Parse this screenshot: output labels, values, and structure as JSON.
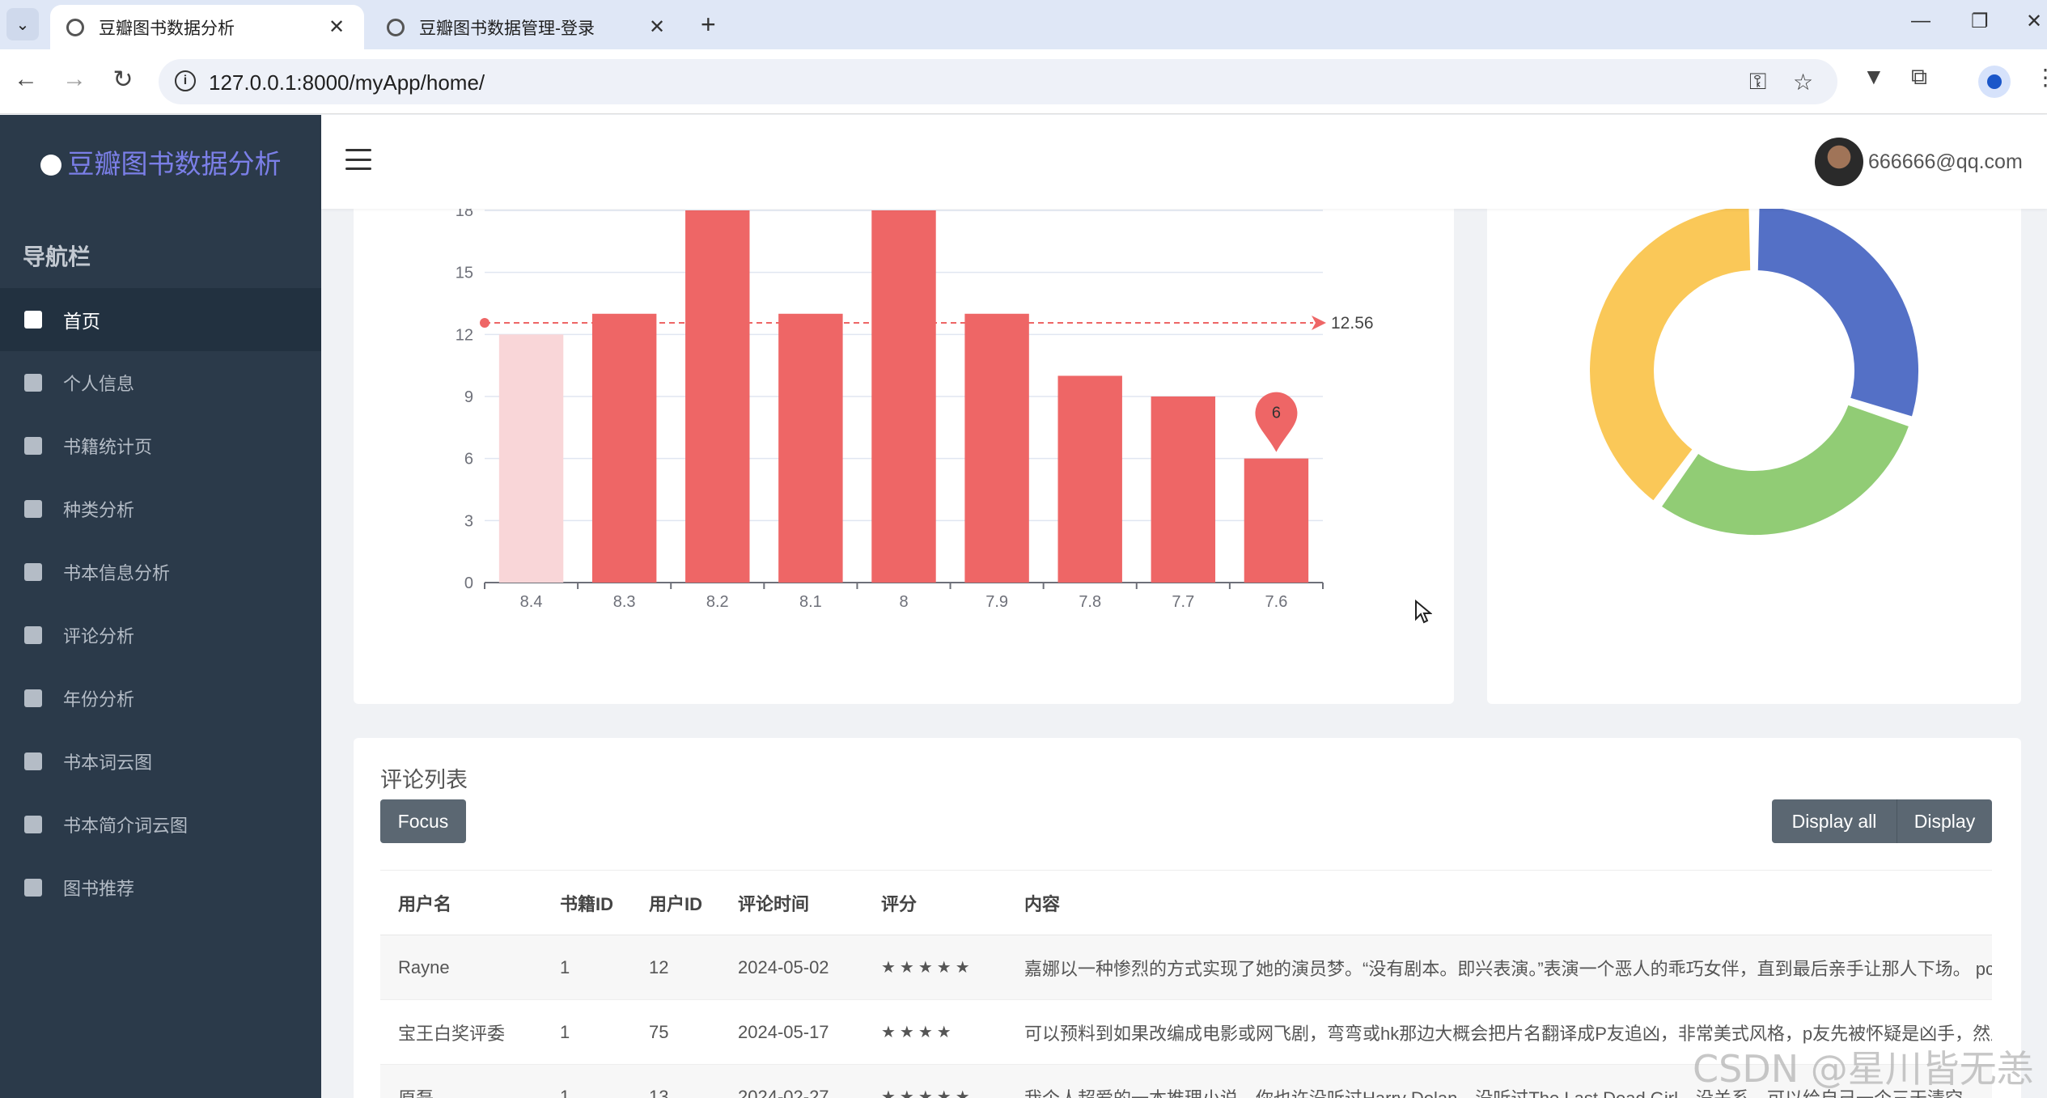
{
  "browser": {
    "tabs": [
      {
        "title": "豆瓣图书数据分析",
        "active": true
      },
      {
        "title": "豆瓣图书数据管理-登录",
        "active": false
      }
    ],
    "url": "127.0.0.1:8000/myApp/home/"
  },
  "app": {
    "brand": "豆瓣图书数据分析",
    "nav_heading": "导航栏",
    "nav_items": [
      {
        "label": "首页",
        "icon": "dashboard-icon",
        "active": true
      },
      {
        "label": "个人信息",
        "icon": "user-info-icon"
      },
      {
        "label": "书籍统计页",
        "icon": "calendar-check-icon"
      },
      {
        "label": "种类分析",
        "icon": "print-icon"
      },
      {
        "label": "书本信息分析",
        "icon": "book-icon"
      },
      {
        "label": "评论分析",
        "icon": "comment-icon"
      },
      {
        "label": "年份分析",
        "icon": "history-icon"
      },
      {
        "label": "书本词云图",
        "icon": "cloud-icon"
      },
      {
        "label": "书本简介词云图",
        "icon": "cloud-upload-icon"
      },
      {
        "label": "图书推荐",
        "icon": "plus-square-icon"
      }
    ],
    "user_email": "666666@qq.com"
  },
  "chart_data": [
    {
      "type": "bar",
      "categories": [
        "8.4",
        "8.3",
        "8.2",
        "8.1",
        "8",
        "7.9",
        "7.8",
        "7.7",
        "7.6"
      ],
      "values": [
        12,
        13,
        18,
        13,
        18,
        13,
        10,
        9,
        6
      ],
      "y_ticks": [
        "0",
        "3",
        "6",
        "9",
        "12",
        "15",
        "18"
      ],
      "ylim": [
        0,
        18
      ],
      "mark_line": {
        "label": "12.56",
        "value": 12.56
      },
      "mark_point": {
        "label": "6",
        "category": "7.6",
        "value": 6
      },
      "color": "#ee6666",
      "highlight_color": "#f9d6d8",
      "grid": true
    },
    {
      "type": "pie",
      "donut": true,
      "slices": [
        {
          "value": 30,
          "color": "#5470c6"
        },
        {
          "value": 30,
          "color": "#91cc75"
        },
        {
          "value": 40,
          "color": "#fac858"
        }
      ]
    }
  ],
  "comments": {
    "title": "评论列表",
    "focus_label": "Focus",
    "display_all_label": "Display all",
    "display_label": "Display",
    "columns": [
      "用户名",
      "书籍ID",
      "用户ID",
      "评论时间",
      "评分",
      "内容"
    ],
    "rows": [
      [
        "Rayne",
        "1",
        "12",
        "2024-05-02",
        "★★★★★",
        "嘉娜以一种惨烈的方式实现了她的演员梦。“没有剧本。即兴表演。”表演一个恶人的乖巧女伴，直到最后亲手让那人下场。 pc"
      ],
      [
        "宝王白奖评委",
        "1",
        "75",
        "2024-05-17",
        "★★★★",
        "可以预料到如果改编成电影或网飞剧，弯弯或hk那边大概会把片名翻译成P友追凶，非常美式风格，p友先被怀疑是凶手，然后"
      ],
      [
        "原磊",
        "1",
        "13",
        "2024-02-27",
        "★★★★★",
        "我个人超爱的一本推理小说，你也许没听过Harry Dolan，没听过The Last Dead Girl，没关系，可以给自己一个三天清空"
      ]
    ]
  },
  "watermark": "CSDN @星川皆无恙"
}
